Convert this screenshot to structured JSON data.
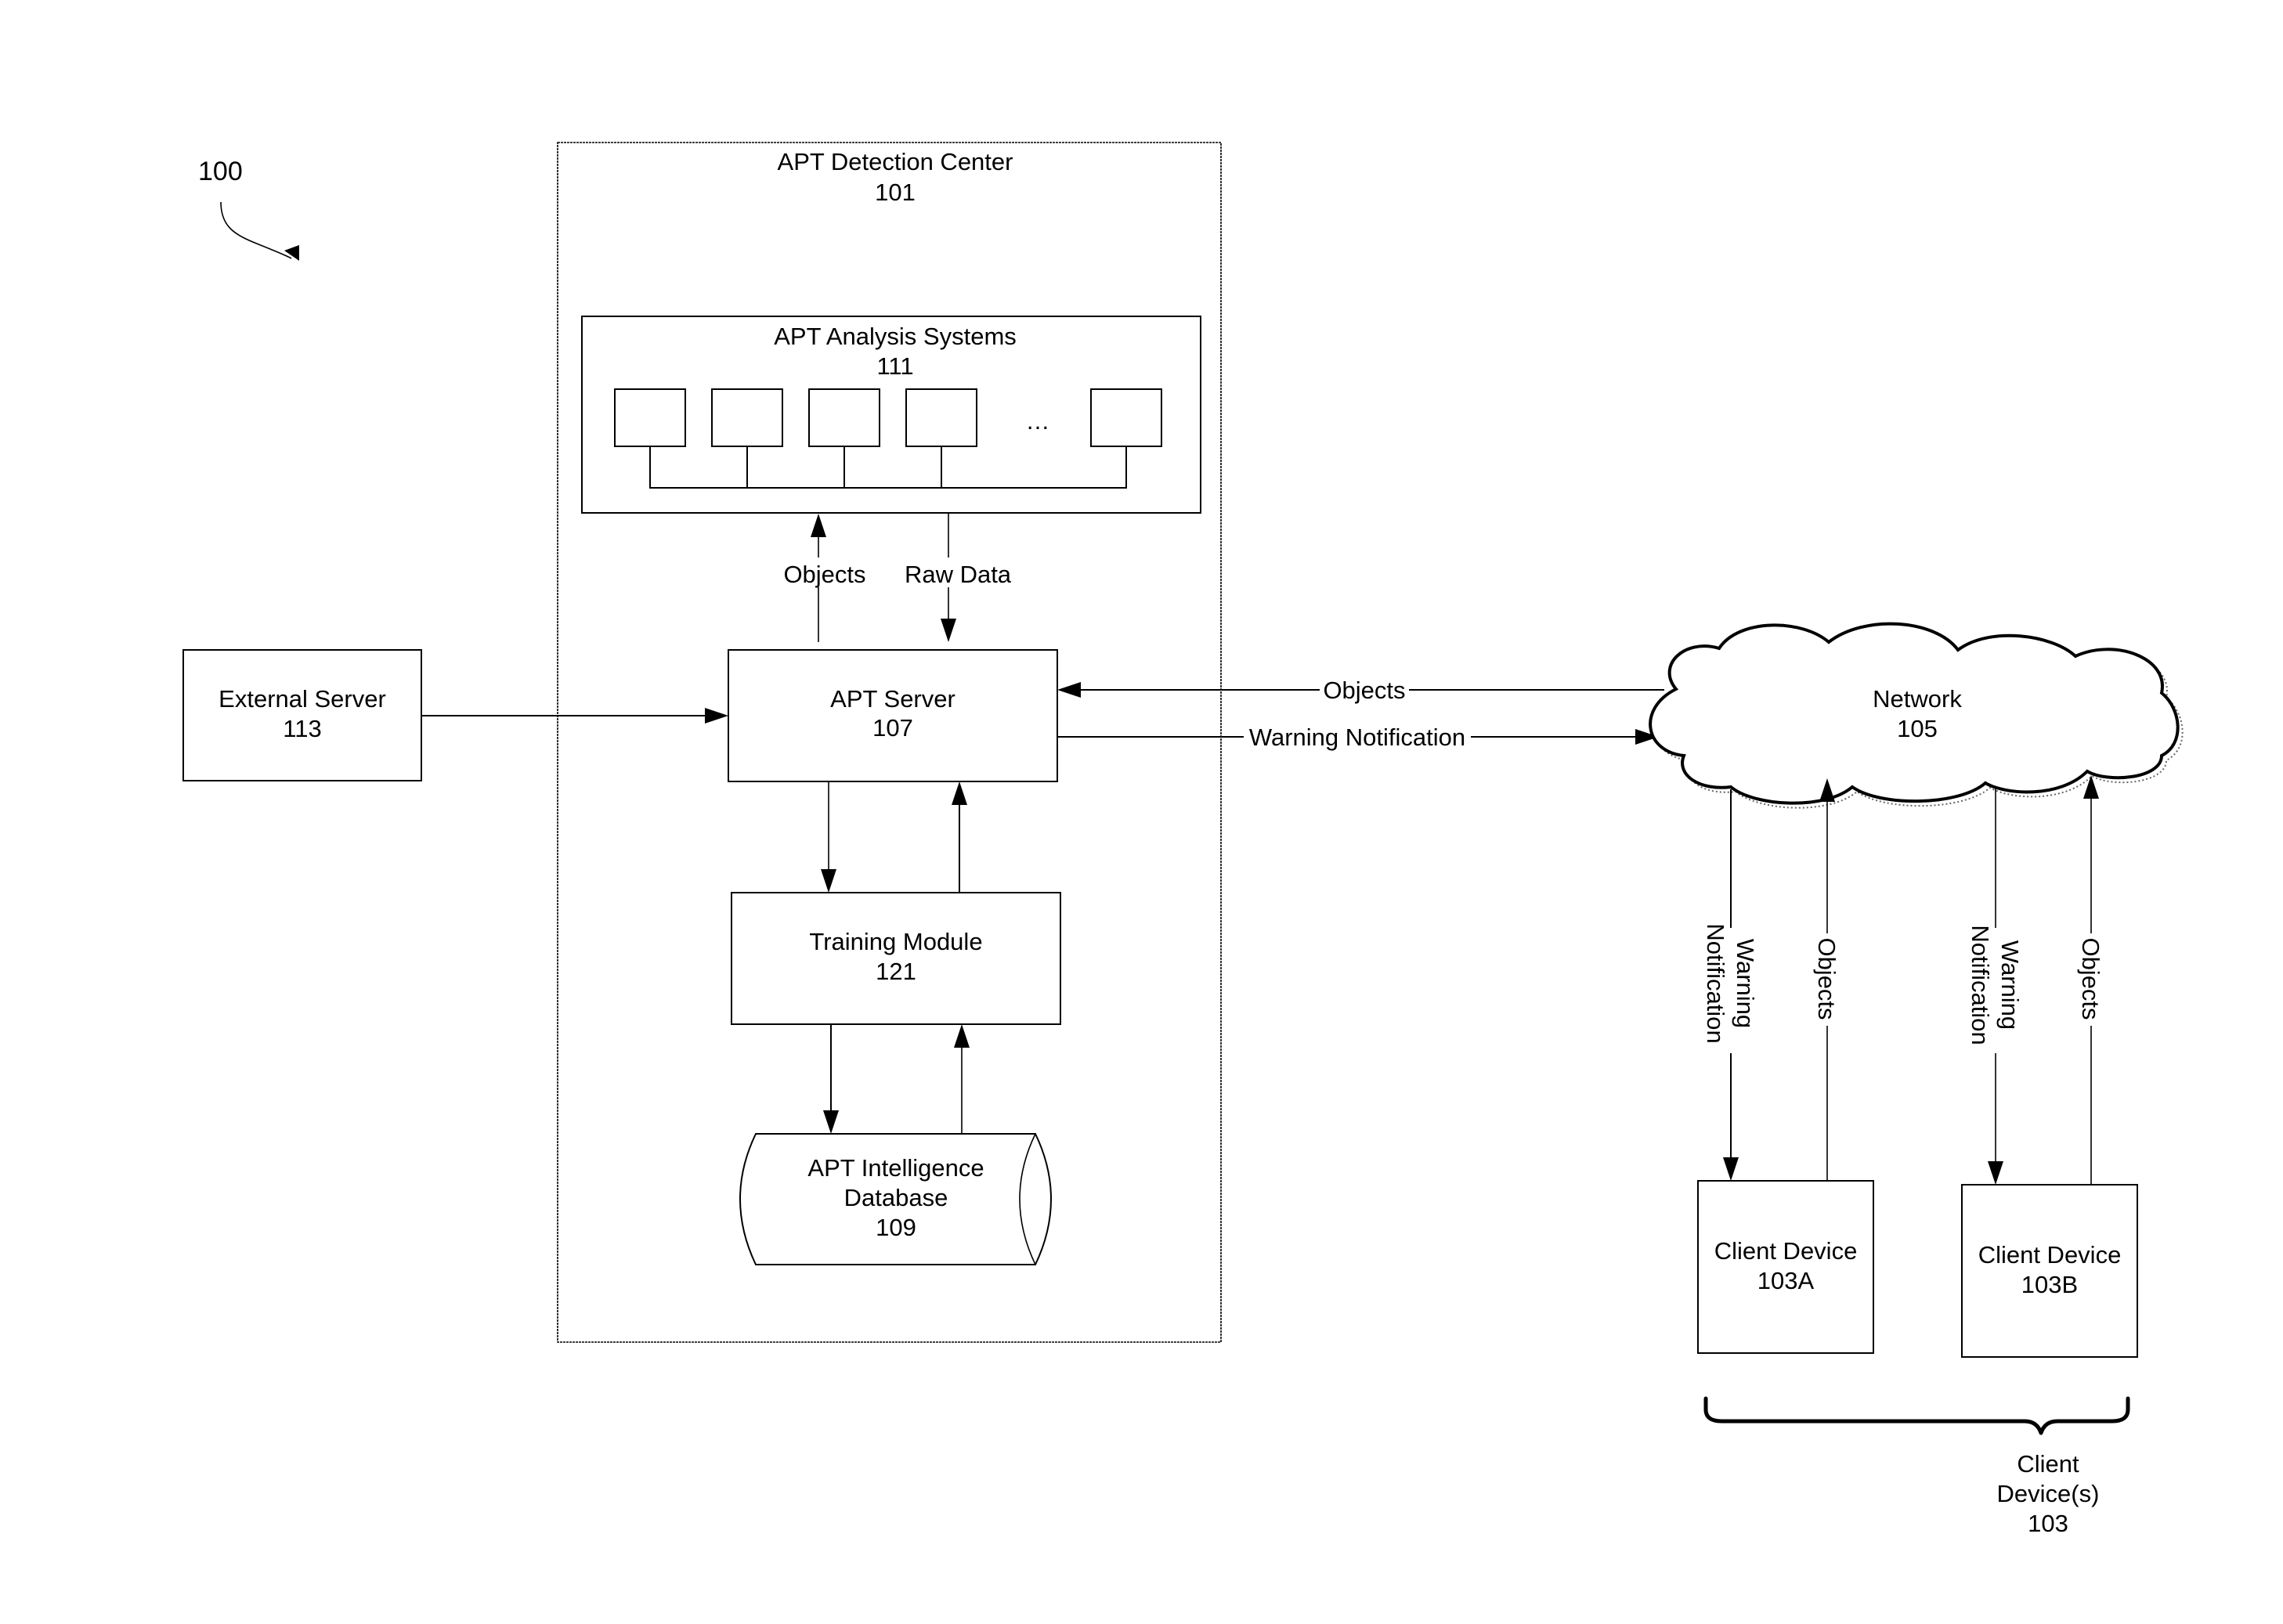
{
  "figure": {
    "reference_label": "100"
  },
  "detection_center": {
    "title": "APT Detection Center",
    "number": "101"
  },
  "analysis_systems": {
    "title": "APT Analysis Systems",
    "number": "111",
    "unit_count_visible": 5,
    "ellipsis": "…"
  },
  "apt_server": {
    "title": "APT Server",
    "number": "107"
  },
  "training_module": {
    "title": "Training Module",
    "number": "121"
  },
  "intelligence_db": {
    "title_line1": "APT Intelligence",
    "title_line2": "Database",
    "number": "109"
  },
  "external_server": {
    "title": "External Server",
    "number": "113"
  },
  "network": {
    "title": "Network",
    "number": "105"
  },
  "client_a": {
    "title": "Client Device",
    "number": "103A"
  },
  "client_b": {
    "title": "Client Device",
    "number": "103B"
  },
  "client_group": {
    "line1": "Client",
    "line2": "Device(s)",
    "number": "103"
  },
  "edges": {
    "server_to_analysis": "Objects",
    "analysis_to_server": "Raw Data",
    "network_to_server": "Objects",
    "server_to_network": "Warning Notification",
    "network_to_client_line1": "Warning",
    "network_to_client_line2": "Notification",
    "client_to_network": "Objects"
  }
}
